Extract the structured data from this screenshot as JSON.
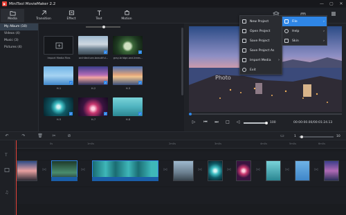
{
  "app": {
    "title": "MiniTool MovieMaker 2.2"
  },
  "window": {
    "minimize": "—",
    "maximize": "▢",
    "close": "✕"
  },
  "toolbar": {
    "media": "Media",
    "transition": "Transition",
    "effect": "Effect",
    "text": "Text",
    "motion": "Motion"
  },
  "sidebar": {
    "items": [
      {
        "label": "My Album (10)"
      },
      {
        "label": "Videos (4)"
      },
      {
        "label": "Music (3)"
      },
      {
        "label": "Pictures (4)"
      }
    ]
  },
  "media_items": [
    {
      "caption": "Import Media Files"
    },
    {
      "caption": "architecture-beautiful..."
    },
    {
      "caption": "gray-bridge-and-trees..."
    },
    {
      "caption": "H-1"
    },
    {
      "caption": "H-2"
    },
    {
      "caption": "H-3"
    },
    {
      "caption": "H-5"
    },
    {
      "caption": "H-7"
    },
    {
      "caption": "H-8"
    }
  ],
  "preview": {
    "watermark": "Photo",
    "zoom": "100",
    "timecode": "00:00:00.00/00:01:24.13"
  },
  "menu": {
    "new_project": "New Project",
    "open_project": "Open Project",
    "save_project": "Save Project",
    "save_project_as": "Save Project As",
    "import_media": "Import Media",
    "exit": "Exit"
  },
  "submenu": {
    "file": "File",
    "help": "Help",
    "skin": "Skin"
  },
  "timeline": {
    "zoom_min": "1",
    "zoom_max": "10",
    "ticks": [
      "0s",
      "1m0s",
      "2m0s",
      "3m0s",
      "4m0s",
      "5m0s",
      "6m0s"
    ]
  },
  "colors": {
    "accent": "#2f86e6",
    "brand": "#e8443a"
  }
}
